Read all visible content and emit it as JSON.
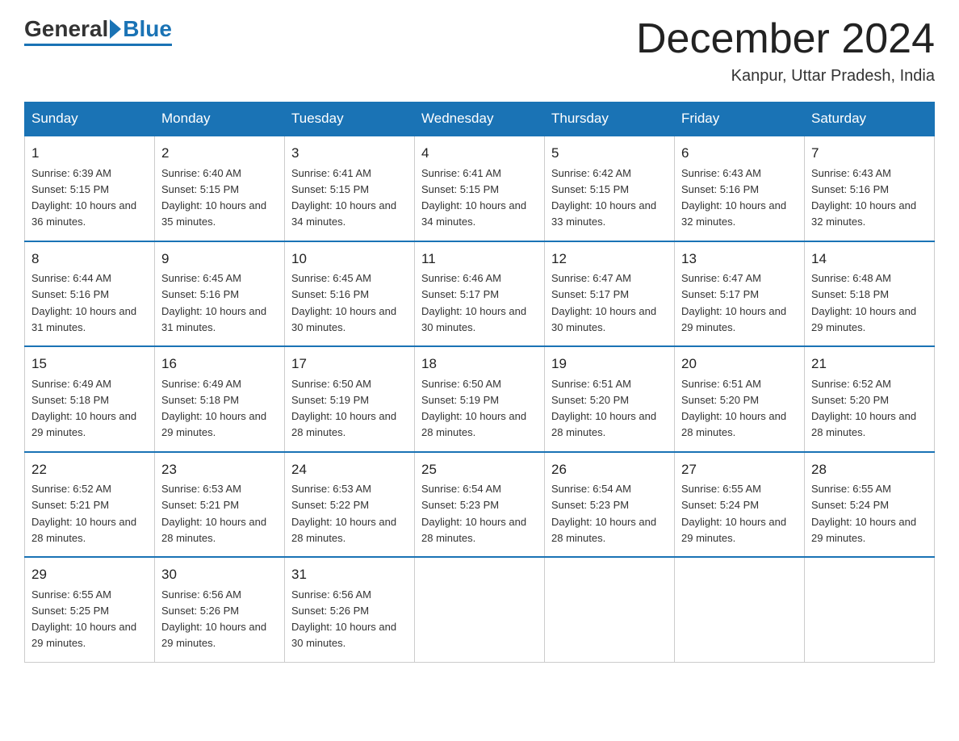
{
  "logo": {
    "text_general": "General",
    "text_blue": "Blue"
  },
  "header": {
    "month_title": "December 2024",
    "location": "Kanpur, Uttar Pradesh, India"
  },
  "weekdays": [
    "Sunday",
    "Monday",
    "Tuesday",
    "Wednesday",
    "Thursday",
    "Friday",
    "Saturday"
  ],
  "weeks": [
    [
      {
        "day": "1",
        "sunrise": "6:39 AM",
        "sunset": "5:15 PM",
        "daylight": "10 hours and 36 minutes."
      },
      {
        "day": "2",
        "sunrise": "6:40 AM",
        "sunset": "5:15 PM",
        "daylight": "10 hours and 35 minutes."
      },
      {
        "day": "3",
        "sunrise": "6:41 AM",
        "sunset": "5:15 PM",
        "daylight": "10 hours and 34 minutes."
      },
      {
        "day": "4",
        "sunrise": "6:41 AM",
        "sunset": "5:15 PM",
        "daylight": "10 hours and 34 minutes."
      },
      {
        "day": "5",
        "sunrise": "6:42 AM",
        "sunset": "5:15 PM",
        "daylight": "10 hours and 33 minutes."
      },
      {
        "day": "6",
        "sunrise": "6:43 AM",
        "sunset": "5:16 PM",
        "daylight": "10 hours and 32 minutes."
      },
      {
        "day": "7",
        "sunrise": "6:43 AM",
        "sunset": "5:16 PM",
        "daylight": "10 hours and 32 minutes."
      }
    ],
    [
      {
        "day": "8",
        "sunrise": "6:44 AM",
        "sunset": "5:16 PM",
        "daylight": "10 hours and 31 minutes."
      },
      {
        "day": "9",
        "sunrise": "6:45 AM",
        "sunset": "5:16 PM",
        "daylight": "10 hours and 31 minutes."
      },
      {
        "day": "10",
        "sunrise": "6:45 AM",
        "sunset": "5:16 PM",
        "daylight": "10 hours and 30 minutes."
      },
      {
        "day": "11",
        "sunrise": "6:46 AM",
        "sunset": "5:17 PM",
        "daylight": "10 hours and 30 minutes."
      },
      {
        "day": "12",
        "sunrise": "6:47 AM",
        "sunset": "5:17 PM",
        "daylight": "10 hours and 30 minutes."
      },
      {
        "day": "13",
        "sunrise": "6:47 AM",
        "sunset": "5:17 PM",
        "daylight": "10 hours and 29 minutes."
      },
      {
        "day": "14",
        "sunrise": "6:48 AM",
        "sunset": "5:18 PM",
        "daylight": "10 hours and 29 minutes."
      }
    ],
    [
      {
        "day": "15",
        "sunrise": "6:49 AM",
        "sunset": "5:18 PM",
        "daylight": "10 hours and 29 minutes."
      },
      {
        "day": "16",
        "sunrise": "6:49 AM",
        "sunset": "5:18 PM",
        "daylight": "10 hours and 29 minutes."
      },
      {
        "day": "17",
        "sunrise": "6:50 AM",
        "sunset": "5:19 PM",
        "daylight": "10 hours and 28 minutes."
      },
      {
        "day": "18",
        "sunrise": "6:50 AM",
        "sunset": "5:19 PM",
        "daylight": "10 hours and 28 minutes."
      },
      {
        "day": "19",
        "sunrise": "6:51 AM",
        "sunset": "5:20 PM",
        "daylight": "10 hours and 28 minutes."
      },
      {
        "day": "20",
        "sunrise": "6:51 AM",
        "sunset": "5:20 PM",
        "daylight": "10 hours and 28 minutes."
      },
      {
        "day": "21",
        "sunrise": "6:52 AM",
        "sunset": "5:20 PM",
        "daylight": "10 hours and 28 minutes."
      }
    ],
    [
      {
        "day": "22",
        "sunrise": "6:52 AM",
        "sunset": "5:21 PM",
        "daylight": "10 hours and 28 minutes."
      },
      {
        "day": "23",
        "sunrise": "6:53 AM",
        "sunset": "5:21 PM",
        "daylight": "10 hours and 28 minutes."
      },
      {
        "day": "24",
        "sunrise": "6:53 AM",
        "sunset": "5:22 PM",
        "daylight": "10 hours and 28 minutes."
      },
      {
        "day": "25",
        "sunrise": "6:54 AM",
        "sunset": "5:23 PM",
        "daylight": "10 hours and 28 minutes."
      },
      {
        "day": "26",
        "sunrise": "6:54 AM",
        "sunset": "5:23 PM",
        "daylight": "10 hours and 28 minutes."
      },
      {
        "day": "27",
        "sunrise": "6:55 AM",
        "sunset": "5:24 PM",
        "daylight": "10 hours and 29 minutes."
      },
      {
        "day": "28",
        "sunrise": "6:55 AM",
        "sunset": "5:24 PM",
        "daylight": "10 hours and 29 minutes."
      }
    ],
    [
      {
        "day": "29",
        "sunrise": "6:55 AM",
        "sunset": "5:25 PM",
        "daylight": "10 hours and 29 minutes."
      },
      {
        "day": "30",
        "sunrise": "6:56 AM",
        "sunset": "5:26 PM",
        "daylight": "10 hours and 29 minutes."
      },
      {
        "day": "31",
        "sunrise": "6:56 AM",
        "sunset": "5:26 PM",
        "daylight": "10 hours and 30 minutes."
      },
      null,
      null,
      null,
      null
    ]
  ]
}
